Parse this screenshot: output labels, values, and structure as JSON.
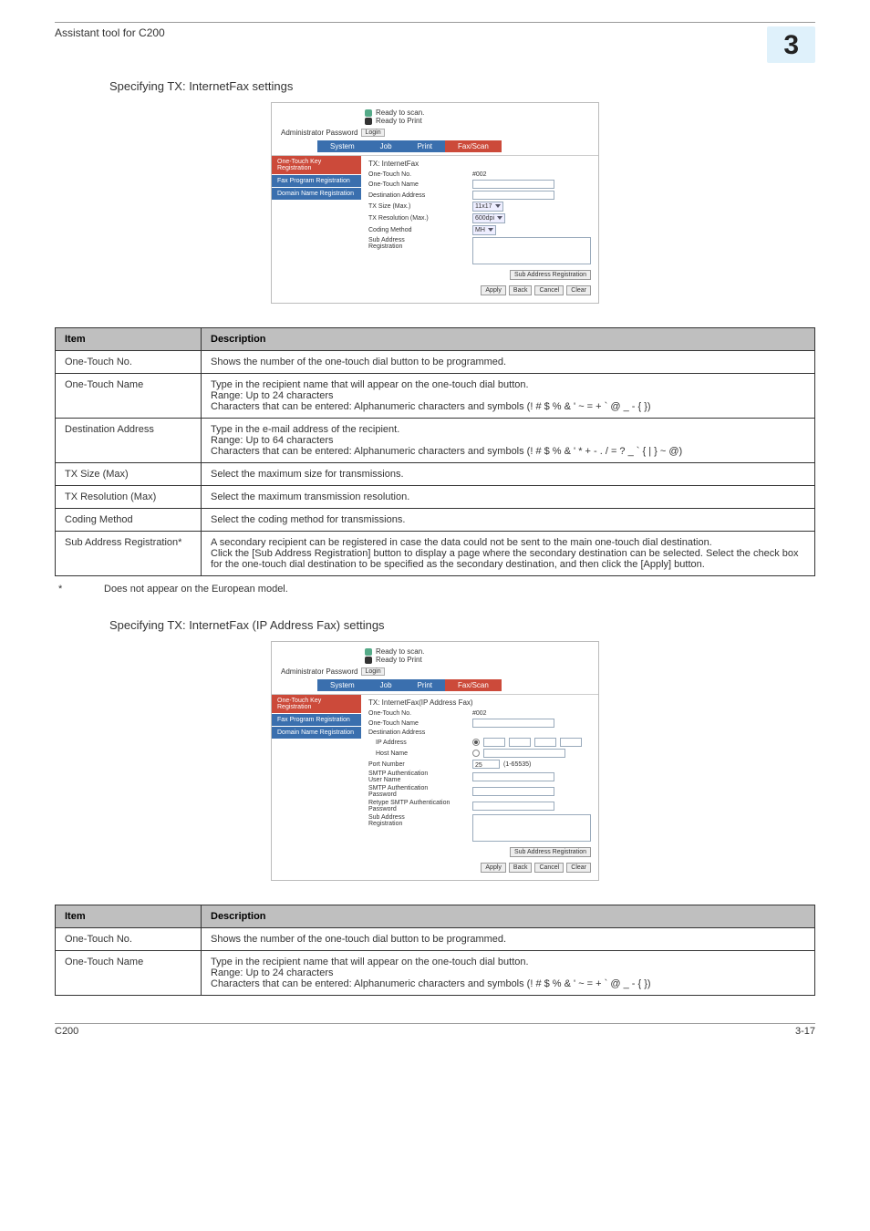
{
  "header": {
    "left": "Assistant tool for C200",
    "right": "3"
  },
  "section1": {
    "title": "Specifying TX: InternetFax settings"
  },
  "section2": {
    "title": "Specifying TX: InternetFax (IP Address Fax) settings"
  },
  "note": {
    "star": "*",
    "text": "Does not appear on the European model."
  },
  "footer": {
    "left": "C200",
    "right": "3-17"
  },
  "table1": {
    "headers": {
      "item": "Item",
      "desc": "Description"
    },
    "rows": [
      {
        "item": "One-Touch No.",
        "desc": "Shows the number of the one-touch dial button to be programmed."
      },
      {
        "item": "One-Touch Name",
        "desc": "Type in the recipient name that will appear on the one-touch dial button.\nRange: Up to 24 characters\nCharacters that can be entered: Alphanumeric characters and symbols (! # $ % & ' ~ = + ` @ _ - { })"
      },
      {
        "item": "Destination Address",
        "desc": "Type in the e-mail address of the recipient.\nRange: Up to 64 characters\nCharacters that can be entered: Alphanumeric characters and symbols (! # $ % & ' * + - . / = ? _ ` { | } ~ @)"
      },
      {
        "item": "TX Size (Max)",
        "desc": "Select the maximum size for transmissions."
      },
      {
        "item": "TX Resolution (Max)",
        "desc": "Select the maximum transmission resolution."
      },
      {
        "item": "Coding Method",
        "desc": "Select the coding method for transmissions."
      },
      {
        "item": "Sub Address Registration*",
        "desc": "A secondary recipient can be registered in case the data could not be sent to the main one-touch dial destination.\nClick the [Sub Address Registration] button to display a page where the secondary destination can be selected. Select the check box for the one-touch dial destination to be specified as the secondary destination, and then click the [Apply] button."
      }
    ]
  },
  "table2": {
    "headers": {
      "item": "Item",
      "desc": "Description"
    },
    "rows": [
      {
        "item": "One-Touch No.",
        "desc": "Shows the number of the one-touch dial button to be programmed."
      },
      {
        "item": "One-Touch Name",
        "desc": "Type in the recipient name that will appear on the one-touch dial button.\nRange: Up to 24 characters\nCharacters that can be entered: Alphanumeric characters and symbols (! # $ % & ' ~ = + ` @ _ - { })"
      }
    ]
  },
  "shot1": {
    "status1": "Ready to scan.",
    "status2": "Ready to Print",
    "admin_label": "Administrator Password",
    "admin_btn": "Login",
    "tabs": {
      "system": "System",
      "job": "Job",
      "print": "Print",
      "faxscan": "Fax/Scan"
    },
    "nav": {
      "n1": "One-Touch Key Registration",
      "n2": "Fax Program Registration",
      "n3": "Domain Name Registration"
    },
    "form_title": "TX: InternetFax",
    "fields": {
      "no_label": "One-Touch No.",
      "no_value": "#002",
      "name_label": "One-Touch Name",
      "dest_label": "Destination Address",
      "txsize_label": "TX Size (Max.)",
      "txsize_value": "11x17",
      "txres_label": "TX Resolution (Max.)",
      "txres_value": "600dpi",
      "coding_label": "Coding Method",
      "coding_value": "MH",
      "sub_label": "Sub Address\nRegistration"
    },
    "buttons": {
      "subreg": "Sub Address Registration",
      "apply": "Apply",
      "back": "Back",
      "cancel": "Cancel",
      "clear": "Clear"
    }
  },
  "shot2": {
    "status1": "Ready to scan.",
    "status2": "Ready to Print",
    "admin_label": "Administrator Password",
    "admin_btn": "Login",
    "tabs": {
      "system": "System",
      "job": "Job",
      "print": "Print",
      "faxscan": "Fax/Scan"
    },
    "nav": {
      "n1": "One-Touch Key Registration",
      "n2": "Fax Program Registration",
      "n3": "Domain Name Registration"
    },
    "form_title": "TX: InternetFax(IP Address Fax)",
    "fields": {
      "no_label": "One-Touch No.",
      "no_value": "#002",
      "name_label": "One-Touch Name",
      "dest_label": "Destination Address",
      "ip_label": "IP Address",
      "host_label": "Host Name",
      "port_label": "Port Number",
      "port_value": "25",
      "port_hint": "(1-65535)",
      "smtp_user_label": "SMTP Authentication\nUser Name",
      "smtp_pass_label": "SMTP Authentication\nPassword",
      "smtp_pass2_label": "Retype SMTP Authentication\nPassword",
      "sub_label": "Sub Address\nRegistration"
    },
    "buttons": {
      "subreg": "Sub Address Registration",
      "apply": "Apply",
      "back": "Back",
      "cancel": "Cancel",
      "clear": "Clear"
    }
  }
}
